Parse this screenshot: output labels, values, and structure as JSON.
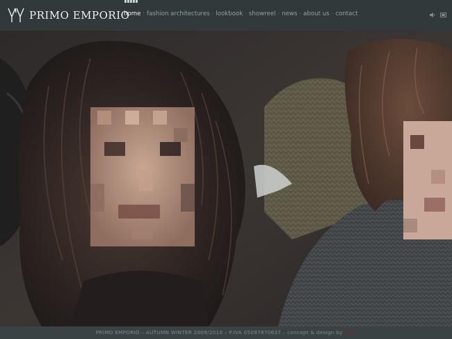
{
  "brand": {
    "name": "PRIMO EMPORIO"
  },
  "nav": {
    "items": [
      {
        "label": "home",
        "active": true
      },
      {
        "label": "fashion architectures",
        "active": false
      },
      {
        "label": "lookbook",
        "active": false
      },
      {
        "label": "showreel",
        "active": false
      },
      {
        "label": "news",
        "active": false
      },
      {
        "label": "about us",
        "active": false
      },
      {
        "label": "contact",
        "active": false
      }
    ],
    "separator": "·"
  },
  "tools": {
    "sound_icon": "speaker-icon",
    "gallery_icon": "slides-icon"
  },
  "footer": {
    "text": "PRIMO EMPORIO – AUTUMN WINTER 2009/2010 – P.IVA 05097870637 – concept & design by",
    "credit": "Mr.X"
  },
  "colors": {
    "header_bg": "#32393b",
    "footer_bg": "#3b4244",
    "credit": "#8a2222"
  }
}
